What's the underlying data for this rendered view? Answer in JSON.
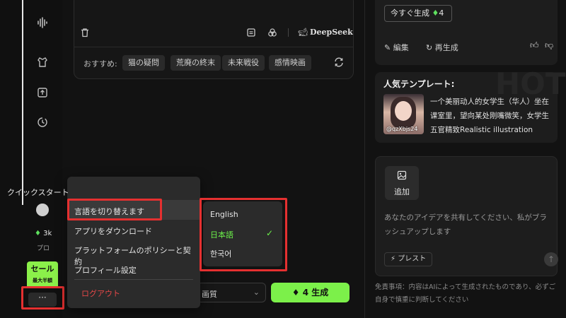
{
  "sidebar": {
    "credits": "3k",
    "plan": "プロ",
    "sale_title": "セール",
    "sale_subtitle": "最大半額",
    "more_label": "···"
  },
  "prompt_card": {
    "model_name": "DeepSeek",
    "recommend_label": "おすすめ:",
    "chips": [
      "猫の疑問",
      "荒廃の終末",
      "未来戦役",
      "感情映画"
    ]
  },
  "controls": {
    "quality_label": "画質",
    "generate_label": "4 生成"
  },
  "menu": {
    "items": [
      "クイックスタート",
      "言語を切り替えます",
      "アプリをダウンロード",
      "プラットフォームのポリシーと契約",
      "プロフィール設定"
    ],
    "logout": "ログアウト"
  },
  "language_menu": {
    "options": [
      "English",
      "日本語",
      "한국어"
    ],
    "selected": "日本語"
  },
  "right_panel": {
    "now_generate": "今すぐ生成",
    "now_generate_cost": "4",
    "edit": "編集",
    "regenerate": "再生成",
    "template_heading": "人気テンプレート:",
    "template_bg_text": "HOT",
    "template_user": "@qzXbjs24",
    "template_text": "一个美丽动人的女学生（华人）坐在课室里，望向某处刚嘴微笑，女学生五官精致Realistic illustration",
    "add_label": "追加",
    "idea_placeholder": "あなたのアイデアを共有してください、私がブラッシュアップします",
    "preset_label": "プレスト",
    "disclaimer": "免責事項：内容はAIによって生成されたものであり、必ずご自身で慎重に判断してください"
  },
  "colors": {
    "accent_green": "#7cf04a",
    "highlight_red": "#e53030",
    "logout_red": "#e54848"
  }
}
